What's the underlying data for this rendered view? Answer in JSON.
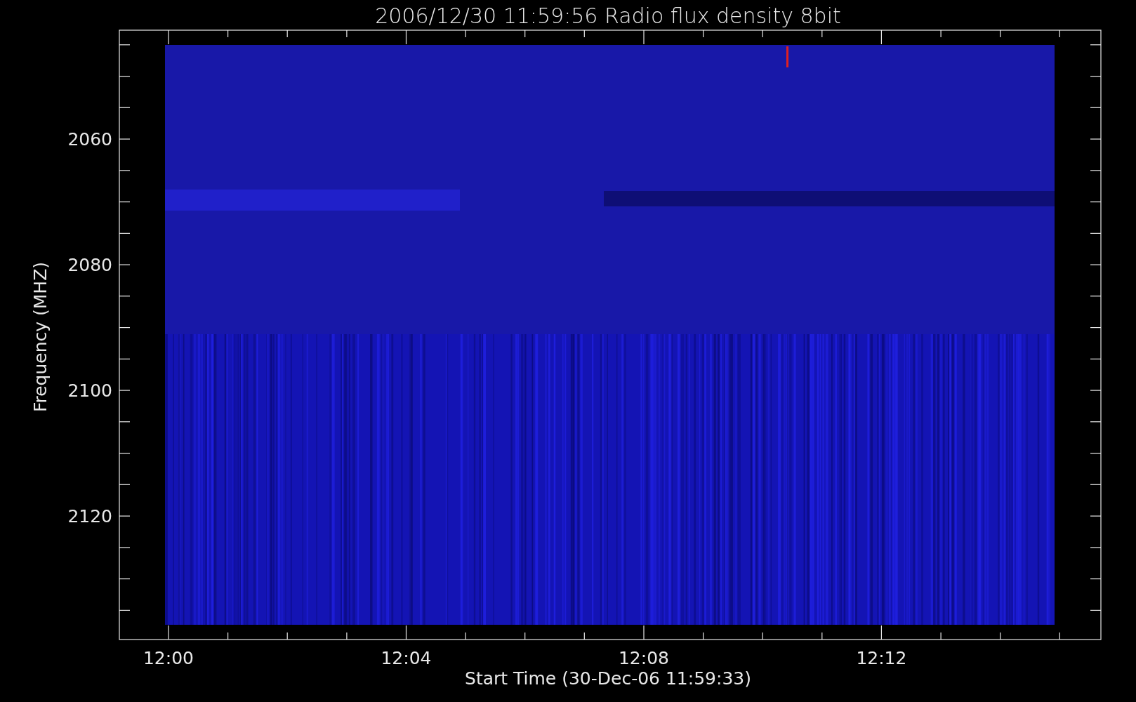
{
  "title": "2006/12/30 11:59:56 Radio flux density 8bit",
  "y_axis": {
    "label": "Frequency (MHZ)",
    "ticks": [
      "2060",
      "2080",
      "2100",
      "2120"
    ]
  },
  "x_axis": {
    "label": "Start Time (30-Dec-06 11:59:33)",
    "ticks": [
      "12:00",
      "12:04",
      "12:08",
      "12:12"
    ]
  }
}
